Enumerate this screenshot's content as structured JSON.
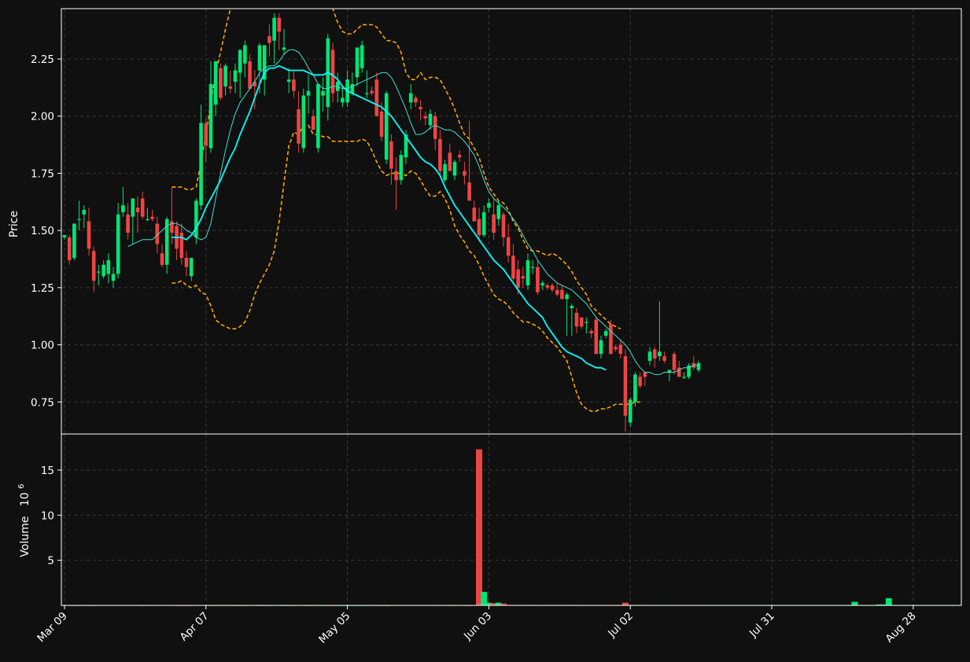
{
  "colors": {
    "background": "#101010",
    "up": "#00e676",
    "down": "#ef4444",
    "ma_fast": "#40e0d0",
    "ma_slow": "#00ffff",
    "bollinger": "#ffa500",
    "grid": "#3a3a3a",
    "frame": "#ffffff",
    "text": "#ffffff"
  },
  "chart_data": {
    "type": "candlestick",
    "grid": true,
    "price_panel": {
      "ylabel": "Price",
      "ylim": [
        0.61,
        2.47
      ],
      "yticks": [
        0.75,
        1.0,
        1.25,
        1.5,
        1.75,
        2.0,
        2.25
      ],
      "ytick_labels": [
        "0.75",
        "1.00",
        "1.25",
        "1.50",
        "1.75",
        "2.00",
        "2.25"
      ]
    },
    "volume_panel": {
      "ylabel": "Volume",
      "multiplier_label": "10",
      "multiplier_exponent": "6",
      "ylim": [
        0,
        19
      ],
      "yticks": [
        5,
        10,
        15
      ],
      "ytick_labels": [
        "5",
        "10",
        "15"
      ]
    },
    "x_axis": {
      "tick_index": [
        0,
        29,
        58,
        87,
        116,
        145,
        174
      ],
      "tick_labels": [
        "Mar 09",
        "Apr 07",
        "May 05",
        "Jun 03",
        "Jul 02",
        "Jul 31",
        "Aug 28"
      ]
    },
    "candles_ohlc": [
      [
        1.47,
        1.48,
        1.46,
        1.48
      ],
      [
        1.47,
        1.48,
        1.35,
        1.37
      ],
      [
        1.38,
        1.53,
        1.37,
        1.53
      ],
      [
        1.55,
        1.63,
        1.5,
        1.55
      ],
      [
        1.57,
        1.61,
        1.51,
        1.59
      ],
      [
        1.54,
        1.6,
        1.39,
        1.42
      ],
      [
        1.41,
        1.43,
        1.23,
        1.28
      ],
      [
        1.32,
        1.35,
        1.26,
        1.32
      ],
      [
        1.3,
        1.37,
        1.29,
        1.35
      ],
      [
        1.31,
        1.4,
        1.27,
        1.37
      ],
      [
        1.28,
        1.34,
        1.25,
        1.31
      ],
      [
        1.31,
        1.62,
        1.29,
        1.57
      ],
      [
        1.58,
        1.69,
        1.56,
        1.61
      ],
      [
        1.57,
        1.62,
        1.46,
        1.49
      ],
      [
        1.56,
        1.64,
        1.44,
        1.64
      ],
      [
        1.6,
        1.65,
        1.49,
        1.58
      ],
      [
        1.64,
        1.67,
        1.55,
        1.56
      ],
      [
        1.55,
        1.6,
        1.54,
        1.55
      ],
      [
        1.56,
        1.59,
        1.54,
        1.55
      ],
      [
        1.53,
        1.56,
        1.4,
        1.44
      ],
      [
        1.4,
        1.44,
        1.34,
        1.35
      ],
      [
        1.35,
        1.56,
        1.31,
        1.55
      ],
      [
        1.54,
        1.69,
        1.44,
        1.49
      ],
      [
        1.52,
        1.54,
        1.37,
        1.42
      ],
      [
        1.49,
        1.53,
        1.35,
        1.38
      ],
      [
        1.38,
        1.41,
        1.3,
        1.34
      ],
      [
        1.3,
        1.38,
        1.28,
        1.38
      ],
      [
        1.47,
        1.64,
        1.44,
        1.63
      ],
      [
        1.61,
        2.05,
        1.59,
        1.97
      ],
      [
        1.97,
        1.99,
        1.8,
        1.87
      ],
      [
        1.86,
        2.24,
        1.84,
        2.14
      ],
      [
        2.05,
        2.24,
        2.0,
        2.24
      ],
      [
        2.21,
        2.23,
        2.07,
        2.08
      ],
      [
        2.13,
        2.23,
        2.09,
        2.22
      ],
      [
        2.13,
        2.2,
        2.1,
        2.12
      ],
      [
        2.15,
        2.23,
        2.1,
        2.2
      ],
      [
        2.19,
        2.29,
        2.08,
        2.29
      ],
      [
        2.23,
        2.33,
        2.17,
        2.31
      ],
      [
        2.24,
        2.27,
        2.15,
        2.12
      ],
      [
        2.15,
        2.2,
        2.03,
        2.13
      ],
      [
        2.2,
        2.32,
        2.1,
        2.31
      ],
      [
        2.16,
        2.29,
        2.09,
        2.31
      ],
      [
        2.35,
        2.4,
        2.26,
        2.32
      ],
      [
        2.33,
        2.45,
        2.23,
        2.43
      ],
      [
        2.43,
        2.45,
        2.29,
        2.37
      ],
      [
        2.29,
        2.38,
        2.27,
        2.3
      ],
      [
        2.15,
        2.21,
        2.1,
        2.16
      ],
      [
        2.16,
        2.2,
        2.08,
        2.11
      ],
      [
        2.03,
        2.11,
        1.84,
        1.88
      ],
      [
        1.86,
        2.12,
        1.84,
        2.09
      ],
      [
        2.09,
        2.18,
        2.01,
        2.11
      ],
      [
        2.0,
        2.03,
        1.94,
        1.94
      ],
      [
        1.86,
        2.14,
        1.84,
        2.14
      ],
      [
        2.09,
        2.17,
        2.02,
        2.11
      ],
      [
        2.04,
        2.36,
        1.98,
        2.34
      ],
      [
        2.29,
        2.32,
        2.06,
        2.1
      ],
      [
        2.11,
        2.19,
        2.06,
        2.15
      ],
      [
        2.06,
        2.13,
        2.04,
        2.08
      ],
      [
        2.06,
        2.2,
        2.04,
        2.16
      ],
      [
        2.1,
        2.19,
        2.09,
        2.14
      ],
      [
        2.17,
        2.3,
        2.13,
        2.3
      ],
      [
        2.21,
        2.33,
        2.19,
        2.31
      ],
      [
        2.1,
        2.2,
        2.08,
        2.1
      ],
      [
        2.11,
        2.13,
        2.09,
        2.1
      ],
      [
        2.16,
        2.19,
        2.05,
        2.0
      ],
      [
        2.02,
        2.06,
        1.89,
        1.91
      ],
      [
        1.81,
        2.11,
        1.79,
        2.1
      ],
      [
        1.89,
        1.92,
        1.7,
        1.77
      ],
      [
        1.76,
        1.82,
        1.59,
        1.72
      ],
      [
        1.72,
        1.85,
        1.7,
        1.83
      ],
      [
        1.82,
        1.94,
        1.79,
        1.92
      ],
      [
        2.06,
        2.14,
        2.03,
        2.1
      ],
      [
        2.08,
        2.09,
        2.04,
        2.06
      ],
      [
        2.04,
        2.07,
        1.98,
        2.03
      ],
      [
        2.0,
        2.02,
        1.96,
        1.99
      ],
      [
        1.96,
        2.03,
        1.94,
        2.01
      ],
      [
        2.0,
        2.02,
        1.85,
        1.9
      ],
      [
        1.9,
        1.94,
        1.73,
        1.76
      ],
      [
        1.72,
        1.81,
        1.71,
        1.79
      ],
      [
        1.84,
        1.88,
        1.76,
        1.76
      ],
      [
        1.74,
        1.81,
        1.72,
        1.8
      ],
      [
        1.83,
        1.85,
        1.8,
        1.82
      ],
      [
        1.76,
        1.8,
        1.7,
        1.74
      ],
      [
        1.71,
        1.98,
        1.65,
        1.63
      ],
      [
        1.6,
        1.63,
        1.54,
        1.54
      ],
      [
        1.55,
        1.6,
        1.45,
        1.48
      ],
      [
        1.48,
        1.61,
        1.47,
        1.58
      ],
      [
        1.6,
        1.64,
        1.58,
        1.62
      ],
      [
        1.57,
        1.64,
        1.46,
        1.49
      ],
      [
        1.55,
        1.63,
        1.52,
        1.61
      ],
      [
        1.57,
        1.58,
        1.43,
        1.47
      ],
      [
        1.47,
        1.53,
        1.36,
        1.39
      ],
      [
        1.39,
        1.44,
        1.28,
        1.29
      ],
      [
        1.33,
        1.37,
        1.22,
        1.25
      ],
      [
        1.3,
        1.34,
        1.25,
        1.29
      ],
      [
        1.26,
        1.4,
        1.24,
        1.37
      ],
      [
        1.34,
        1.37,
        1.31,
        1.34
      ],
      [
        1.34,
        1.37,
        1.22,
        1.23
      ],
      [
        1.26,
        1.28,
        1.24,
        1.27
      ],
      [
        1.26,
        1.27,
        1.24,
        1.25
      ],
      [
        1.26,
        1.27,
        1.23,
        1.24
      ],
      [
        1.24,
        1.27,
        1.21,
        1.22
      ],
      [
        1.24,
        1.26,
        1.21,
        1.2
      ],
      [
        1.2,
        1.23,
        1.04,
        1.22
      ],
      [
        1.16,
        1.18,
        1.04,
        1.17
      ],
      [
        1.14,
        1.16,
        1.05,
        1.08
      ],
      [
        1.12,
        1.12,
        1.07,
        1.08
      ],
      [
        1.1,
        1.12,
        1.05,
        1.1
      ],
      [
        1.06,
        1.07,
        1.03,
        1.05
      ],
      [
        1.11,
        1.12,
        0.99,
        0.96
      ],
      [
        0.96,
        1.04,
        0.94,
        1.02
      ],
      [
        1.04,
        1.07,
        1.03,
        1.06
      ],
      [
        1.09,
        1.11,
        0.96,
        0.96
      ],
      [
        0.99,
        1.0,
        0.97,
        0.98
      ],
      [
        1.0,
        1.02,
        0.94,
        0.96
      ],
      [
        0.95,
        0.98,
        0.62,
        0.69
      ],
      [
        0.66,
        0.77,
        0.64,
        0.76
      ],
      [
        0.75,
        0.88,
        0.73,
        0.87
      ],
      [
        0.86,
        0.88,
        0.81,
        0.82
      ],
      [
        0.88,
        0.88,
        0.82,
        0.86
      ],
      [
        0.93,
        0.99,
        0.91,
        0.97
      ],
      [
        0.98,
        0.99,
        0.9,
        0.94
      ],
      [
        0.95,
        1.19,
        0.93,
        0.97
      ],
      [
        0.95,
        0.97,
        0.92,
        0.93
      ],
      [
        0.88,
        0.89,
        0.84,
        0.89
      ],
      [
        0.96,
        0.97,
        0.87,
        0.89
      ],
      [
        0.9,
        0.93,
        0.86,
        0.86
      ],
      [
        0.86,
        0.88,
        0.85,
        0.86
      ],
      [
        0.86,
        0.92,
        0.85,
        0.91
      ],
      [
        0.92,
        0.95,
        0.89,
        0.9
      ],
      [
        0.89,
        0.93,
        0.88,
        0.92
      ]
    ],
    "volume_millions": [
      0.02,
      0.02,
      0.01,
      0.02,
      0.02,
      0.01,
      0.01,
      0.02,
      0.02,
      0.04,
      0.02,
      0.04,
      0.05,
      0.04,
      0.03,
      0.02,
      0.01,
      0.02,
      0.05,
      0.03,
      0.04,
      0.04,
      0.02,
      0.01,
      0.01,
      0.01,
      0.02,
      0.02,
      0.04,
      0.02,
      0.02,
      0.01,
      0.02,
      0.02,
      0.01,
      0.01,
      0.02,
      0.01,
      0.02,
      0.02,
      0.01,
      0.01,
      0.01,
      0.02,
      0.02,
      0.01,
      0.01,
      0.01,
      0.02,
      0.02,
      0.01,
      0.01,
      0.02,
      0.01,
      0.02,
      0.01,
      0.02,
      0.01,
      0.01,
      0.02,
      0.01,
      0.02,
      0.01,
      0.02,
      0.01,
      0.01,
      0.01,
      0.02,
      0.02,
      0.02,
      0.02,
      0.02,
      0.02,
      0.02,
      0.02,
      0.02,
      0.02,
      0.02,
      0.02,
      0.01,
      0.02,
      0.02,
      0.01,
      0.01,
      0.02,
      17.3,
      1.5,
      0.3,
      0.25,
      0.3,
      0.2,
      0.05,
      0.05,
      0.05,
      0.05,
      0.05,
      0.05,
      0.05,
      0.03,
      0.05,
      0.05,
      0.05,
      0.05,
      0.05,
      0.05,
      0.02,
      0.02,
      0.02,
      0.02,
      0.05,
      0.02,
      0.02,
      0.02,
      0.02,
      0.02,
      0.3,
      0.05,
      0.05,
      0.05,
      0.05,
      0.02,
      0.02,
      0.02,
      0.02,
      0.02,
      0.02,
      0.02,
      0.02,
      0.02,
      0.02,
      0.02,
      0.02,
      0.02,
      0.02,
      0.02,
      0.02,
      0.02,
      0.02,
      0.02,
      0.02,
      0.02,
      0.02,
      0.02,
      0.02,
      0.02,
      0.02,
      0.02,
      0.02,
      0.02,
      0.02,
      0.02,
      0.02,
      0.02,
      0.02,
      0.02,
      0.02,
      0.02,
      0.02,
      0.02,
      0.02,
      0.02,
      0.02,
      0.4,
      0.05,
      0.05,
      0.02,
      0.05,
      0.1,
      0.1,
      0.8,
      0.05,
      0.05,
      0.02,
      0.02,
      0.02,
      0.02,
      0.02,
      0.02,
      0.02,
      0.02,
      0.02,
      0.02,
      0.02,
      0.02
    ],
    "volume_offset": 70,
    "ma_fast_ohlc_start": 13,
    "ma_fast": [
      1.43,
      1.44,
      1.45,
      1.46,
      1.46,
      1.46,
      1.48,
      1.5,
      1.52,
      1.53,
      1.53,
      1.52,
      1.5,
      1.49,
      1.47,
      1.46,
      1.47,
      1.53,
      1.64,
      1.75,
      1.85,
      1.94,
      2.01,
      2.06,
      2.09,
      2.12,
      2.15,
      2.19,
      2.21,
      2.22,
      2.22,
      2.24,
      2.27,
      2.29,
      2.29,
      2.28,
      2.25,
      2.21,
      2.18,
      2.14,
      2.12,
      2.12,
      2.13,
      2.13,
      2.12,
      2.12,
      2.13,
      2.14,
      2.15,
      2.16,
      2.17,
      2.18,
      2.19,
      2.19,
      2.17,
      2.13,
      2.08,
      2.03,
      1.97,
      1.92,
      1.92,
      1.93,
      1.95,
      1.96,
      1.95,
      1.94,
      1.94,
      1.93,
      1.91,
      1.89,
      1.86,
      1.83,
      1.78,
      1.72,
      1.67,
      1.64,
      1.62,
      1.6,
      1.58,
      1.55,
      1.52,
      1.48,
      1.44,
      1.41,
      1.37,
      1.34,
      1.31,
      1.29,
      1.27,
      1.26,
      1.25,
      1.24,
      1.22,
      1.2,
      1.18,
      1.15,
      1.12,
      1.1,
      1.08,
      1.06,
      1.04,
      1.02,
      1.0,
      0.97,
      0.93,
      0.9,
      0.88,
      0.88,
      0.87,
      0.87,
      0.88,
      0.88,
      0.88,
      0.89,
      0.9,
      0.9,
      0.91,
      0.91
    ],
    "ma_slow_ohlc_start": 22,
    "ma_slow": [
      1.47,
      1.47,
      1.47,
      1.46,
      1.48,
      1.51,
      1.55,
      1.6,
      1.64,
      1.68,
      1.72,
      1.77,
      1.82,
      1.86,
      1.92,
      1.97,
      2.02,
      2.08,
      2.14,
      2.19,
      2.21,
      2.21,
      2.22,
      2.21,
      2.2,
      2.2,
      2.2,
      2.2,
      2.19,
      2.18,
      2.18,
      2.18,
      2.19,
      2.18,
      2.16,
      2.13,
      2.11,
      2.1,
      2.09,
      2.08,
      2.07,
      2.06,
      2.05,
      2.04,
      2.02,
      2.0,
      1.97,
      1.94,
      1.91,
      1.88,
      1.85,
      1.82,
      1.8,
      1.79,
      1.77,
      1.74,
      1.69,
      1.65,
      1.61,
      1.58,
      1.55,
      1.52,
      1.49,
      1.46,
      1.43,
      1.4,
      1.37,
      1.35,
      1.33,
      1.3,
      1.27,
      1.24,
      1.21,
      1.18,
      1.16,
      1.14,
      1.12,
      1.08,
      1.05,
      1.02,
      0.99,
      0.97,
      0.96,
      0.95,
      0.94,
      0.92,
      0.91,
      0.9,
      0.9,
      0.89
    ],
    "bollinger_ohlc_start": 22,
    "bollinger_upper": [
      1.69,
      1.69,
      1.69,
      1.68,
      1.68,
      1.69,
      1.8,
      1.92,
      2.06,
      2.19,
      2.28,
      2.38,
      2.47,
      2.52,
      2.55,
      2.58,
      2.6,
      2.6,
      2.59,
      2.57,
      2.55,
      2.52,
      2.5,
      2.49,
      2.48,
      2.49,
      2.49,
      2.5,
      2.48,
      2.49,
      2.49,
      2.48,
      2.48,
      2.47,
      2.41,
      2.37,
      2.36,
      2.36,
      2.38,
      2.4,
      2.4,
      2.4,
      2.39,
      2.36,
      2.33,
      2.33,
      2.32,
      2.28,
      2.19,
      2.16,
      2.16,
      2.19,
      2.16,
      2.17,
      2.17,
      2.16,
      2.12,
      2.08,
      2.03,
      1.97,
      1.92,
      1.9,
      1.86,
      1.82,
      1.75,
      1.69,
      1.66,
      1.63,
      1.62,
      1.59,
      1.54,
      1.51,
      1.46,
      1.42,
      1.41,
      1.41,
      1.4,
      1.39,
      1.4,
      1.39,
      1.37,
      1.35,
      1.32,
      1.28,
      1.25,
      1.22,
      1.17,
      1.15,
      1.13,
      1.11,
      1.09,
      1.08,
      1.07
    ],
    "bollinger_lower": [
      1.27,
      1.27,
      1.28,
      1.26,
      1.25,
      1.26,
      1.23,
      1.22,
      1.17,
      1.11,
      1.09,
      1.08,
      1.07,
      1.07,
      1.08,
      1.1,
      1.15,
      1.22,
      1.27,
      1.31,
      1.35,
      1.41,
      1.54,
      1.71,
      1.87,
      1.93,
      1.92,
      1.96,
      1.96,
      1.92,
      1.92,
      1.91,
      1.91,
      1.89,
      1.89,
      1.89,
      1.89,
      1.89,
      1.89,
      1.9,
      1.89,
      1.85,
      1.8,
      1.76,
      1.74,
      1.75,
      1.75,
      1.75,
      1.74,
      1.76,
      1.75,
      1.72,
      1.68,
      1.65,
      1.65,
      1.67,
      1.64,
      1.59,
      1.52,
      1.48,
      1.45,
      1.41,
      1.39,
      1.35,
      1.3,
      1.26,
      1.22,
      1.2,
      1.19,
      1.17,
      1.14,
      1.12,
      1.1,
      1.1,
      1.09,
      1.08,
      1.06,
      1.03,
      1.01,
      0.99,
      0.96,
      0.93,
      0.86,
      0.79,
      0.74,
      0.72,
      0.71,
      0.71,
      0.72,
      0.72,
      0.73,
      0.74,
      0.74,
      0.74,
      0.74,
      0.75,
      0.75
    ]
  }
}
